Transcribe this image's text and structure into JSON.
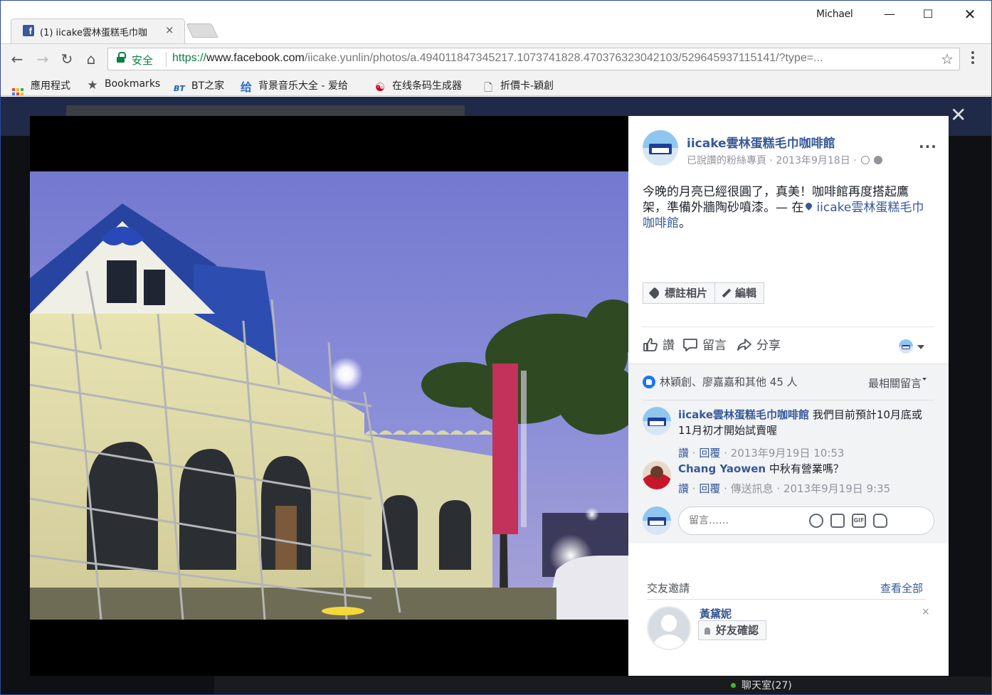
{
  "browser": {
    "tab_title": "(1) iicake雲林蛋糕毛巾咖",
    "tab_close": "×",
    "user_name": "Michael",
    "window_buttons": {
      "minimize": "—",
      "maximize": "☐",
      "close": "✕"
    },
    "nav": {
      "back": "←",
      "forward": "→",
      "reload": "↻",
      "home": "⌂"
    },
    "secure_label": "安全",
    "url_scheme": "https://",
    "url_host": "www.facebook.com",
    "url_path": "/iicake.yunlin/photos/a.494011847345217.1073741828.470376323042103/529645937115141/?type=...",
    "star": "☆",
    "bookmarks": [
      {
        "label": "應用程式",
        "icon": "apps-grid-icon"
      },
      {
        "label": "Bookmarks",
        "icon": "star-icon",
        "glyph": "★"
      },
      {
        "label": "BT之家",
        "icon": "bt-icon",
        "glyph": "BT"
      },
      {
        "label": "背景音乐大全 - 爱给",
        "icon": "aigei-icon",
        "glyph": "给"
      },
      {
        "label": "在线条码生成器",
        "icon": "barcode-site-icon",
        "glyph": "☯"
      },
      {
        "label": "折價卡-穎創",
        "icon": "document-icon",
        "glyph": "🗋"
      }
    ]
  },
  "theater": {
    "close": "✕",
    "chat_label": "聊天室(27)"
  },
  "post": {
    "page_name": "iicake雲林蛋糕毛巾咖啡館",
    "meta": "已說讚的粉絲專頁 · 2013年9月18日 ·",
    "more": "···",
    "text": "今晚的月亮已經很圓了，真美！咖啡館再度搭起鷹架，準備外牆陶砂噴漆。— 在",
    "location": "iicake雲林蛋糕毛巾咖啡館",
    "text_end": "。",
    "tag_button": "標註相片",
    "edit_button": "編輯",
    "actions": {
      "like": "讚",
      "comment": "留言",
      "share": "分享"
    }
  },
  "feedback": {
    "likes_text": "林穎創、廖嘉嘉和其他 45 人",
    "sort_label": "最相關留言",
    "comments": [
      {
        "author": "iicake雲林蛋糕毛巾咖啡館",
        "text": "我們目前預計10月底或11月初才開始試賣喔",
        "like": "讚",
        "reply": "回覆",
        "time": "· 2013年9月19日 10:53"
      },
      {
        "author": "Chang Yaowen",
        "text": "中秋有營業嗎？",
        "like": "讚",
        "reply": "回覆",
        "time": "· 傳送訊息 · 2013年9月19日 9:35"
      }
    ],
    "composer_placeholder": "留言……",
    "composer_icons": [
      "emoji-icon",
      "camera-icon",
      "gif-icon",
      "sticker-icon"
    ],
    "gif_label": "GIF"
  },
  "friend_requests": {
    "title": "交友邀請",
    "see_all": "查看全部",
    "name": "黃黛妮",
    "confirm": "好友確認",
    "dismiss": "×"
  },
  "colors": {
    "fb_link": "#365899",
    "secure_green": "#0b8043",
    "like_blue": "#1877f2",
    "sky": "#7a82d4"
  }
}
